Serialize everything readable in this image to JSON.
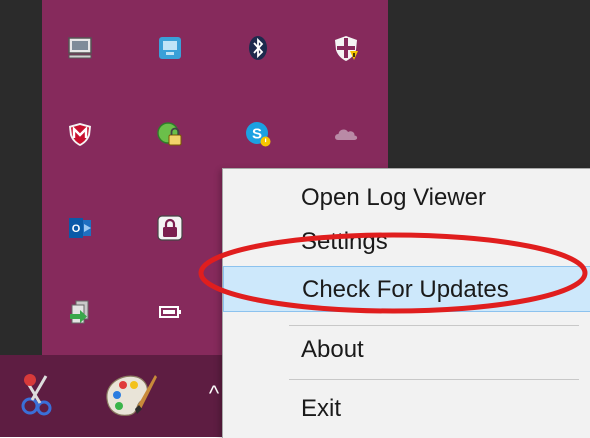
{
  "context_menu": {
    "items": [
      {
        "label": "Open Log Viewer"
      },
      {
        "label": "Settings"
      },
      {
        "label": "Check For Updates",
        "highlighted": true
      },
      {
        "label": "About"
      },
      {
        "label": "Exit"
      }
    ]
  },
  "tray_icons": [
    "monitor-icon",
    "network-manager-icon",
    "bluetooth-icon",
    "windows-defender-icon",
    "mcafee-icon",
    "vpn-lock-icon",
    "skype-icon",
    "onedrive-icon",
    "outlook-icon",
    "lock-icon",
    "sync-icon",
    "battery-icon"
  ],
  "taskbar_icons": [
    "snipping-tool-icon",
    "paint-icon",
    "show-hidden-icons-chevron-icon"
  ],
  "colors": {
    "tray_background": "#862a5c",
    "taskbar_background": "#5e1d42",
    "menu_background": "#f2f2f2",
    "menu_highlight": "#cde8fb",
    "annotation_red": "#e01e1e"
  },
  "taskbar": {
    "chevron_glyph": "^"
  }
}
